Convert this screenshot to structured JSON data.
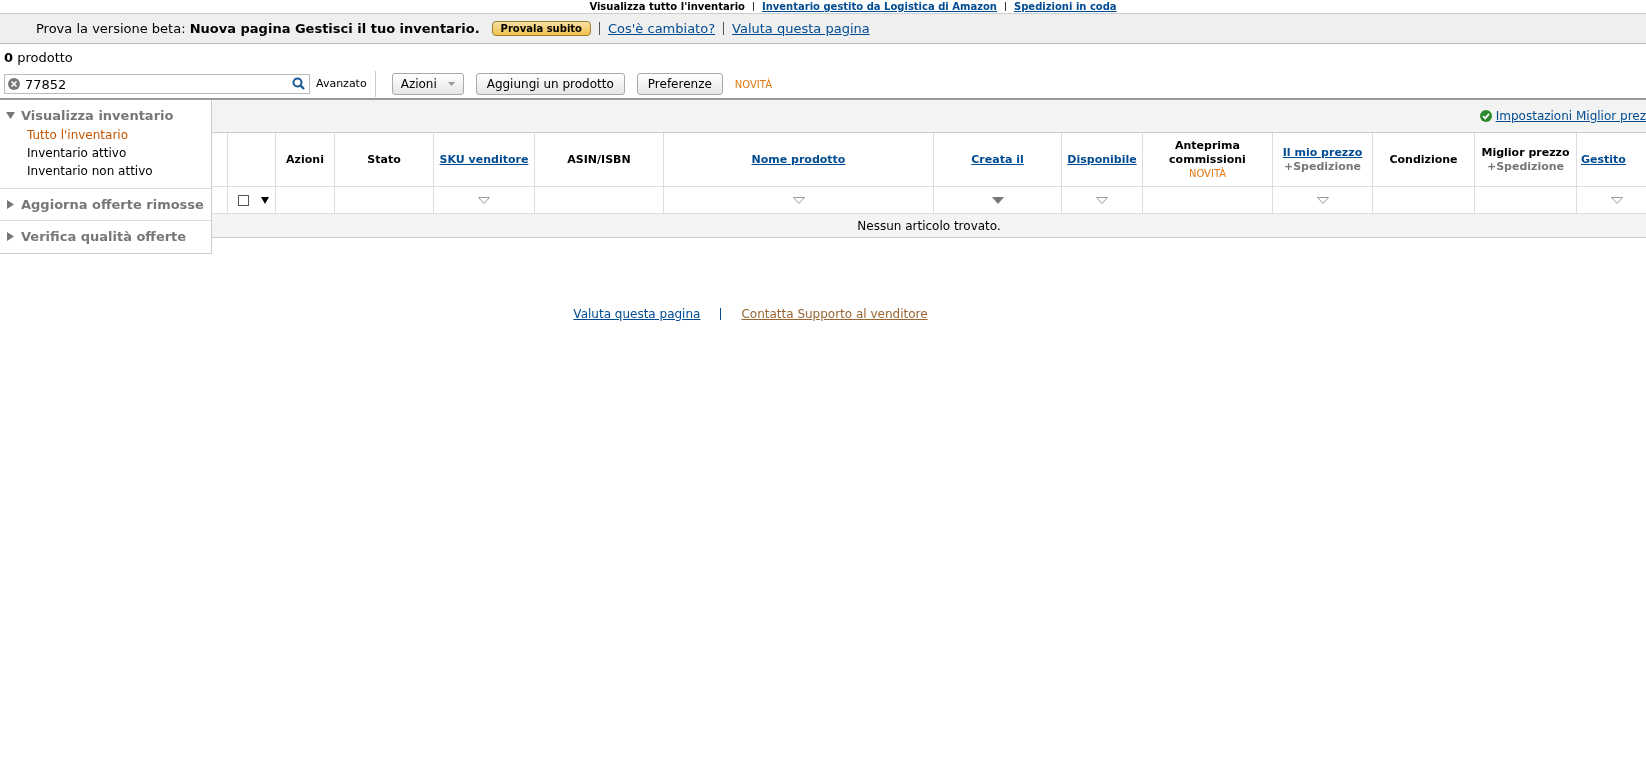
{
  "top_nav": [
    {
      "label": "Visualizza tutto l'inventario",
      "link": false
    },
    {
      "label": "Inventario gestito da Logistica di Amazon",
      "link": true
    },
    {
      "label": "Spedizioni in coda",
      "link": true
    }
  ],
  "beta_bar": {
    "text": "Prova la versione beta: **Nuova pagina Gestisci il tuo inventario.**",
    "button": "Provala subito",
    "links": [
      "Cos'è cambiato?",
      "Valuta questa pagina"
    ]
  },
  "product_count": "**0** prodotto",
  "toolbar": {
    "search": {
      "value": "77852"
    },
    "advanced": "Avanzato",
    "actions": "Azioni",
    "add_product": "Aggiungi un prodotto",
    "preferences": "Preferenze",
    "new_tag": "NOVITÀ"
  },
  "sidebar": [
    {
      "title": "Visualizza inventario",
      "expanded": true,
      "items": [
        {
          "label": "Tutto l'inventario",
          "selected": true
        },
        {
          "label": "Inventario attivo",
          "selected": false
        },
        {
          "label": "Inventario non attivo",
          "selected": false
        }
      ]
    },
    {
      "title": "Aggiorna offerte rimosse",
      "expanded": false
    },
    {
      "title": "Verifica qualità offerte",
      "expanded": false
    }
  ],
  "best_price_settings": "Impostazioni Miglior prez",
  "table": {
    "select_all": {
      "checked": false
    },
    "columns": [
      {
        "label": "Azioni",
        "link": false
      },
      {
        "label": "Stato",
        "link": false
      },
      {
        "label": "SKU venditore",
        "link": true,
        "filter": {
          "kind": "open"
        }
      },
      {
        "label": "ASIN/ISBN",
        "link": false
      },
      {
        "label": "Nome prodotto",
        "link": true,
        "filter": {
          "kind": "open"
        }
      },
      {
        "label": "Creata il",
        "link": true,
        "filter": {
          "kind": "active"
        }
      },
      {
        "label": "Disponibile",
        "link": true,
        "filter": {
          "kind": "open"
        }
      },
      {
        "label": "Anteprima commissioni",
        "link": false,
        "tag": "NOVITÀ"
      },
      {
        "label": "Il mio prezzo",
        "link": true,
        "sub": "+Spedizione",
        "filter": {
          "kind": "open"
        }
      },
      {
        "label": "Condizione",
        "link": false
      },
      {
        "label": "Miglior prezzo",
        "link": false,
        "sub": "+Spedizione"
      },
      {
        "label": "Gestito",
        "link": true,
        "filter": {
          "kind": "open"
        }
      }
    ],
    "empty_message": "Nessun articolo trovato."
  },
  "footer": {
    "links": [
      {
        "label": "Valuta questa pagina",
        "kind": "blue"
      },
      {
        "label": "Contatta Supporto al venditore",
        "kind": "brown"
      }
    ]
  }
}
